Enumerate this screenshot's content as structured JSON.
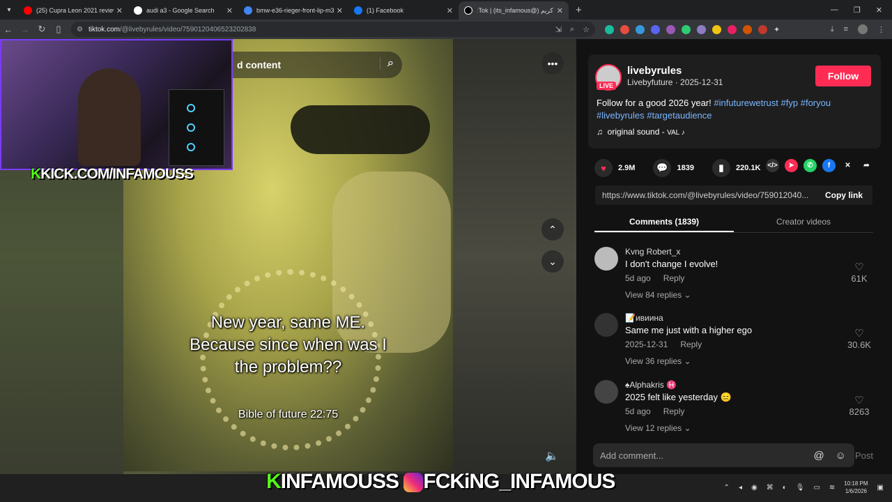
{
  "browser": {
    "tabs": [
      {
        "title": "(25) Cupra Leon 2021 review -",
        "color": "#ff0000"
      },
      {
        "title": "audi a3 - Google Search",
        "color": "#ffffff"
      },
      {
        "title": "bmw-e36-rieger-front-lip-m3-",
        "color": "#4285f4"
      },
      {
        "title": "(1) Facebook",
        "color": "#1877f2"
      },
      {
        "title": "ːTok | (its_infamous@) كريم",
        "color": "#000000"
      }
    ],
    "url_domain": "tiktok.com",
    "url_path": "/@livebyrules/video/7590120406523202838"
  },
  "video": {
    "search_text": "d content",
    "caption_lines": [
      "New year, same ME.",
      "Because since when was I",
      "the problem??"
    ],
    "sub_caption": "Bible of future 22:75"
  },
  "overlay": {
    "kick_top": "KICK.COM/INFAMOUSS",
    "kick_k": "K",
    "bottom_kick": "INFAMOUSS",
    "bottom_ig": "FCKiNG_INFAMOUS"
  },
  "post": {
    "username": "livebyrules",
    "live_badge": "LIVE",
    "display": "Livebyfuture · 2025-12-31",
    "follow": "Follow",
    "desc_text": "Follow for a good 2026 year!",
    "hashtags": [
      "#infuturewetrust",
      "#fyp",
      "#foryou",
      "#livebyrules",
      "#targetaudience"
    ],
    "sound": "original sound - ",
    "sound_artist": "VAL ♪",
    "likes": "2.9M",
    "comments": "1839",
    "saves": "220.1K",
    "link": "https://www.tiktok.com/@livebyrules/video/759012040...",
    "copy_link": "Copy link",
    "tab_comments": "Comments (1839)",
    "tab_creator": "Creator videos"
  },
  "comments": [
    {
      "name": "Kvng Robert_x",
      "text": "I don't change I evolve!",
      "date": "5d ago",
      "reply": "Reply",
      "replies": "View 84 replies",
      "likes": "61K"
    },
    {
      "name": "📝ивиина",
      "text": "Same me just with a higher ego",
      "date": "2025-12-31",
      "reply": "Reply",
      "replies": "View 36 replies",
      "likes": "30.6K"
    },
    {
      "name": "♠Alphakris ♓",
      "text": "2025 felt like yesterday 😑",
      "date": "5d ago",
      "reply": "Reply",
      "replies": "View 12 replies",
      "likes": "8263"
    }
  ],
  "add_comment": {
    "placeholder": "Add comment...",
    "post": "Post"
  },
  "clock": {
    "time": "10:18 PM",
    "date": "1/6/2026"
  }
}
